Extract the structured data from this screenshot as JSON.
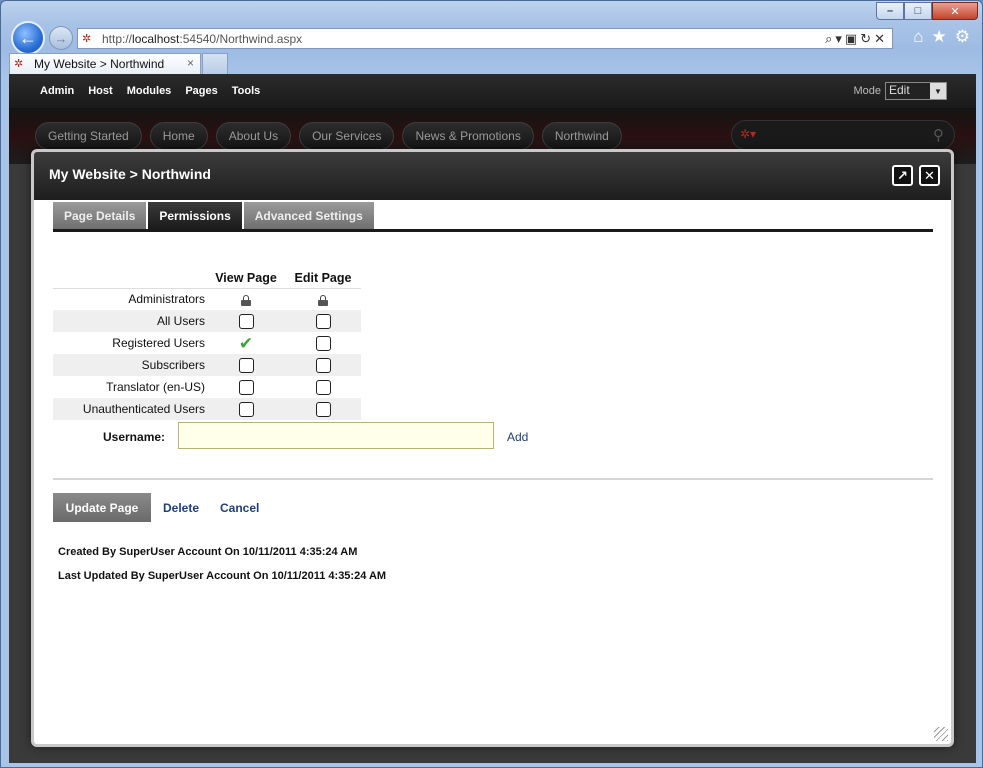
{
  "browser": {
    "url_prefix": "http://",
    "url_host": "localhost",
    "url_rest": ":54540/Northwind.aspx",
    "tab_title": "My Website > Northwind",
    "tab_close": "×",
    "win_min": "–",
    "win_max": "□",
    "win_close": "✕",
    "back_glyph": "←",
    "forward_glyph": "→",
    "addr_tools_glyphs": "⌕▾▣↻✕",
    "icons": [
      "home-icon",
      "favorites-icon",
      "tools-icon"
    ]
  },
  "control_bar": {
    "items": [
      "Admin",
      "Host",
      "Modules",
      "Pages",
      "Tools"
    ],
    "mode_label": "Mode",
    "mode_value": "Edit"
  },
  "site_nav": {
    "items": [
      "Getting Started",
      "Home",
      "About Us",
      "Our Services",
      "News & Promotions",
      "Northwind"
    ]
  },
  "modal": {
    "title": "My Website > Northwind",
    "tabs": [
      "Page Details",
      "Permissions",
      "Advanced Settings"
    ],
    "active_tab": "Permissions",
    "columns": [
      "View Page",
      "Edit Page"
    ],
    "rows": [
      {
        "role": "Administrators",
        "view": "locked",
        "edit": "locked"
      },
      {
        "role": "All Users",
        "view": "unchecked",
        "edit": "unchecked"
      },
      {
        "role": "Registered Users",
        "view": "granted",
        "edit": "unchecked"
      },
      {
        "role": "Subscribers",
        "view": "unchecked",
        "edit": "unchecked"
      },
      {
        "role": "Translator (en-US)",
        "view": "unchecked",
        "edit": "unchecked"
      },
      {
        "role": "Unauthenticated Users",
        "view": "unchecked",
        "edit": "unchecked"
      }
    ],
    "username_label": "Username:",
    "username_value": "",
    "add_label": "Add",
    "update_label": "Update Page",
    "delete_label": "Delete",
    "cancel_label": "Cancel",
    "created_by": "Created By SuperUser Account On 10/11/2011 4:35:24 AM",
    "updated_by": "Last Updated By SuperUser Account On 10/11/2011 4:35:24 AM"
  },
  "colors": {
    "link": "#1f3f7a",
    "granted": "#3aa53a",
    "modal_header": "#1e1e1e",
    "input_bg": "#ffffea"
  }
}
